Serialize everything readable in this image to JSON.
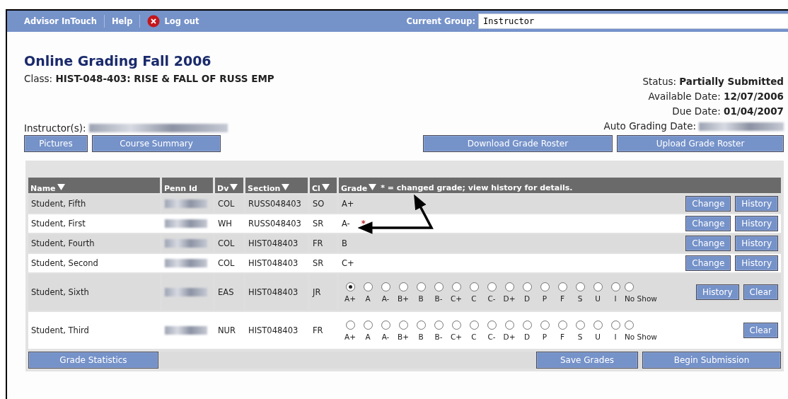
{
  "nav": {
    "links": [
      {
        "kind": "link",
        "label": "Advisor InTouch"
      },
      {
        "kind": "link",
        "label": "Help"
      },
      {
        "kind": "logout",
        "label": "Log out"
      }
    ],
    "group_label": "Current Group:",
    "group_value": "Instructor"
  },
  "title": "Online Grading Fall 2006",
  "class_label": "Class:",
  "class_value": "HIST-048-403: RISE & FALL OF RUSS EMP",
  "instructor_label": "Instructor(s):",
  "info": [
    {
      "label": "Status:",
      "value": "Partially Submitted"
    },
    {
      "label": "Available Date:",
      "value": "12/07/2006"
    },
    {
      "label": "Due Date:",
      "value": "01/04/2007"
    },
    {
      "label": "Auto Grading Date:"
    }
  ],
  "left_buttons": [
    "Pictures",
    "Course Summary"
  ],
  "right_buttons": [
    "Download Grade Roster",
    "Upload Grade Roster"
  ],
  "table": {
    "columns": [
      {
        "label": "Name",
        "sortable": true
      },
      {
        "label": "Penn Id",
        "sortable": false
      },
      {
        "label": "Dv",
        "sortable": true
      },
      {
        "label": "Section",
        "sortable": true
      },
      {
        "label": "Cl",
        "sortable": true
      },
      {
        "label": "Grade",
        "sortable": true
      }
    ],
    "grade_note": "* = changed grade; view history for details.",
    "rows": [
      {
        "kind": "letter",
        "name": "Student, Fifth",
        "dv": "COL",
        "section": "RUSS048403",
        "cl": "SO",
        "grade": "A+",
        "buttons": [
          "Change",
          "History"
        ]
      },
      {
        "kind": "letter",
        "name": "Student, First",
        "dv": "WH",
        "section": "RUSS048403",
        "cl": "SR",
        "grade": "A-",
        "change_mark": "*",
        "buttons": [
          "Change",
          "History"
        ]
      },
      {
        "kind": "letter",
        "name": "Student, Fourth",
        "dv": "COL",
        "section": "HIST048403",
        "cl": "FR",
        "grade": "B",
        "buttons": [
          "Change",
          "History"
        ]
      },
      {
        "kind": "letter",
        "name": "Student, Second",
        "dv": "COL",
        "section": "HIST048403",
        "cl": "SR",
        "grade": "C+",
        "buttons": [
          "Change",
          "History"
        ]
      },
      {
        "kind": "radio",
        "name": "Student, Sixth",
        "dv": "EAS",
        "section": "HIST048403",
        "cl": "JR",
        "buttons": [
          "History",
          "Clear"
        ],
        "options": [
          {
            "label": "A+",
            "selected": true
          },
          {
            "label": "A",
            "selected": false
          },
          {
            "label": "A-",
            "selected": false
          },
          {
            "label": "B+",
            "selected": false
          },
          {
            "label": "B",
            "selected": false
          },
          {
            "label": "B-",
            "selected": false
          },
          {
            "label": "C+",
            "selected": false
          },
          {
            "label": "C",
            "selected": false
          },
          {
            "label": "C-",
            "selected": false
          },
          {
            "label": "D+",
            "selected": false
          },
          {
            "label": "D",
            "selected": false
          },
          {
            "label": "P",
            "selected": false
          },
          {
            "label": "F",
            "selected": false
          },
          {
            "label": "S",
            "selected": false
          },
          {
            "label": "U",
            "selected": false
          },
          {
            "label": "I",
            "selected": false
          },
          {
            "label": "No Show",
            "selected": false
          }
        ]
      },
      {
        "kind": "radio",
        "name": "Student, Third",
        "dv": "NUR",
        "section": "HIST048403",
        "cl": "FR",
        "buttons": [
          "Clear"
        ],
        "options": [
          {
            "label": "A+",
            "selected": false
          },
          {
            "label": "A",
            "selected": false
          },
          {
            "label": "A-",
            "selected": false
          },
          {
            "label": "B+",
            "selected": false
          },
          {
            "label": "B",
            "selected": false
          },
          {
            "label": "B-",
            "selected": false
          },
          {
            "label": "C+",
            "selected": false
          },
          {
            "label": "C",
            "selected": false
          },
          {
            "label": "C-",
            "selected": false
          },
          {
            "label": "D+",
            "selected": false
          },
          {
            "label": "D",
            "selected": false
          },
          {
            "label": "P",
            "selected": false
          },
          {
            "label": "F",
            "selected": false
          },
          {
            "label": "S",
            "selected": false
          },
          {
            "label": "U",
            "selected": false
          },
          {
            "label": "I",
            "selected": false
          },
          {
            "label": "No Show",
            "selected": false
          }
        ]
      }
    ]
  },
  "footer_left": "Grade Statistics",
  "footer_right": [
    "Save Grades",
    "Begin Submission"
  ]
}
